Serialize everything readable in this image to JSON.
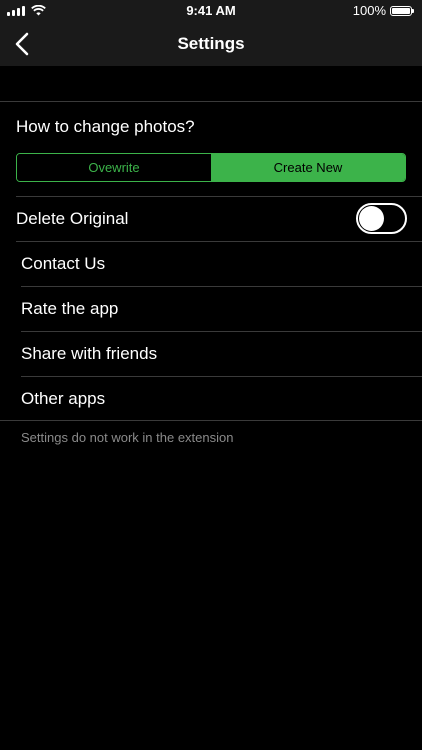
{
  "status_bar": {
    "time": "9:41 AM",
    "battery": "100%",
    "icons": [
      "signal-icon",
      "wifi-icon",
      "battery-icon"
    ]
  },
  "nav": {
    "title": "Settings",
    "back_icon": "chevron-left-icon"
  },
  "photo_mode": {
    "header": "How to change photos?",
    "options": [
      "Ovewrite",
      "Create New"
    ],
    "selected": "Create New"
  },
  "delete_original": {
    "label": "Delete Original",
    "enabled": false
  },
  "menu": {
    "items": [
      {
        "label": "Contact Us"
      },
      {
        "label": "Rate the app"
      },
      {
        "label": "Share with friends"
      },
      {
        "label": "Other apps"
      }
    ]
  },
  "footer": {
    "note": "Settings do not work in the extension"
  },
  "colors": {
    "accent": "#3cb34a",
    "background": "#000000",
    "bar": "#1a1a1a",
    "separator": "#3a3a3a",
    "muted_text": "#8a8a8a"
  }
}
